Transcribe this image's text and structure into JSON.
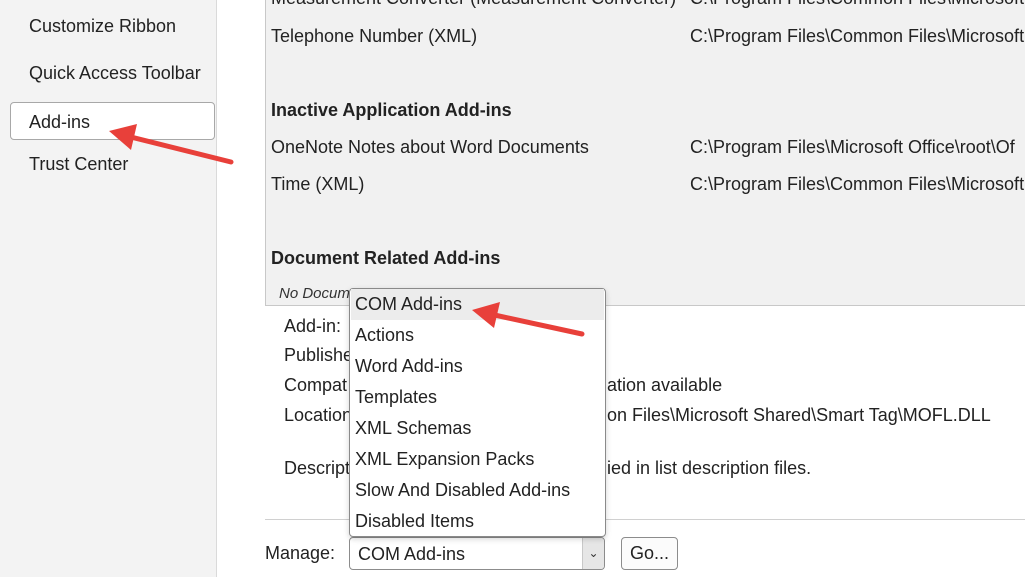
{
  "sidebar": {
    "items": [
      {
        "label": "Customize Ribbon",
        "selected": false
      },
      {
        "label": "Quick Access Toolbar",
        "selected": false
      },
      {
        "label": "Add-ins",
        "selected": true
      },
      {
        "label": "Trust Center",
        "selected": false
      }
    ]
  },
  "addins": {
    "rows": [
      {
        "name": "Measurement Converter (Measurement Converter)",
        "location": "C:\\Program Files\\Common Files\\Microsoft"
      },
      {
        "name": "Telephone Number (XML)",
        "location": "C:\\Program Files\\Common Files\\Microsoft"
      },
      {
        "name": "OneNote Notes about Word Documents",
        "location": "C:\\Program Files\\Microsoft Office\\root\\Of"
      },
      {
        "name": "Time (XML)",
        "location": "C:\\Program Files\\Common Files\\Microsoft"
      }
    ],
    "inactive_heading": "Inactive Application Add-ins",
    "document_heading": "Document Related Add-ins",
    "no_document_text": "No Docum"
  },
  "details": {
    "addin_label": "Add-in:",
    "publisher_label": "Publishe",
    "compat_label": "Compat",
    "compat_value": "ation available",
    "location_label": "Location",
    "location_value": "on Files\\Microsoft Shared\\Smart Tag\\MOFL.DLL",
    "description_label": "Descript",
    "description_value": "ied in list description files."
  },
  "manage": {
    "label": "Manage:",
    "selected": "COM Add-ins",
    "go_label": "Go...",
    "arrow_glyph": "⌄",
    "options": [
      "COM Add-ins",
      "Actions",
      "Word Add-ins",
      "Templates",
      "XML Schemas",
      "XML Expansion Packs",
      "Slow And Disabled Add-ins",
      "Disabled Items"
    ]
  },
  "colors": {
    "annotation_arrow": "#e8403a",
    "sidebar_bg": "#f3f3f3",
    "list_bg": "#f1f1f1"
  }
}
